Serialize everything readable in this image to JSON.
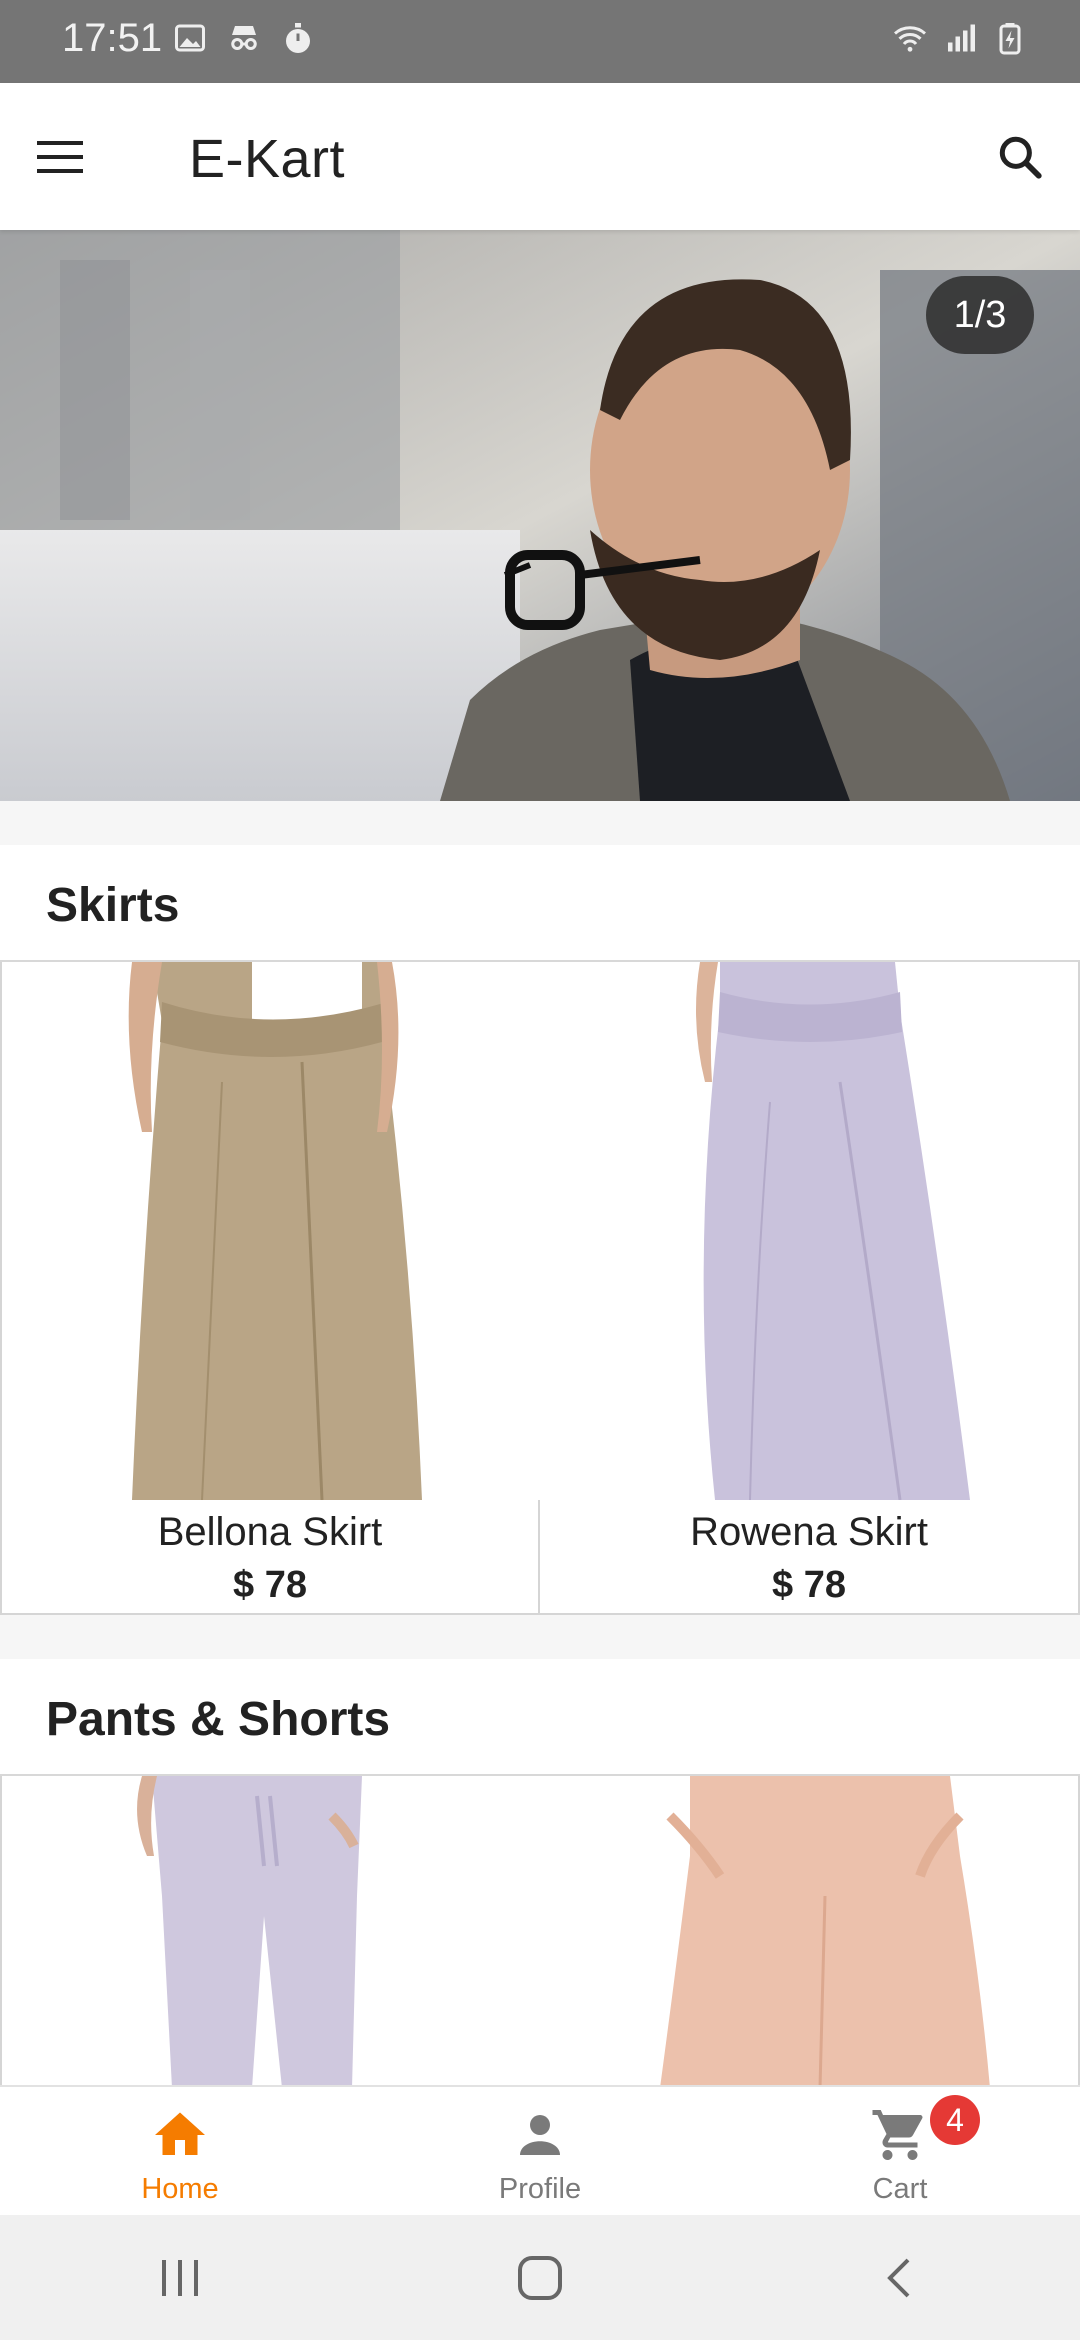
{
  "status_bar": {
    "time": "17:51",
    "left_icons": [
      "image-icon",
      "incognito-icon",
      "timer-icon"
    ],
    "right_icons": [
      "wifi-icon",
      "signal-icon",
      "battery-charging-icon"
    ]
  },
  "app_bar": {
    "title": "E-Kart",
    "menu_icon": "menu-icon",
    "search_icon": "search-icon"
  },
  "banner": {
    "counter": "1/3"
  },
  "sections": [
    {
      "title": "Skirts",
      "products": [
        {
          "name": "Bellona Skirt",
          "price": "$ 78",
          "color": "#b9a586"
        },
        {
          "name": "Rowena Skirt",
          "price": "$ 78",
          "color": "#c9c2dc"
        }
      ]
    },
    {
      "title": "Pants & Shorts",
      "products": [
        {
          "name": "",
          "price": "",
          "color": "#cfc8de"
        },
        {
          "name": "",
          "price": "",
          "color": "#ecc1ac"
        }
      ]
    }
  ],
  "bottom_nav": {
    "items": [
      {
        "label": "Home",
        "icon": "home-icon",
        "active": true
      },
      {
        "label": "Profile",
        "icon": "person-icon",
        "active": false
      },
      {
        "label": "Cart",
        "icon": "cart-icon",
        "active": false,
        "badge": "4"
      }
    ],
    "active_color": "#f57c00",
    "inactive_color": "#7a7a7a"
  },
  "system_nav": [
    "recent-apps-icon",
    "home-circle-icon",
    "back-icon"
  ]
}
